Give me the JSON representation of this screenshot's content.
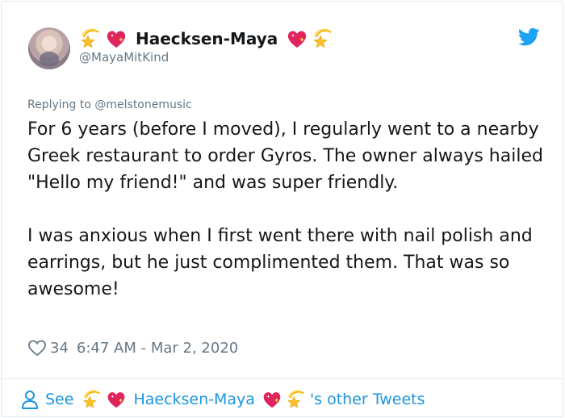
{
  "user": {
    "display_name": "Haecksen-Maya",
    "handle": "@MayaMitKind"
  },
  "reply": {
    "text": "Replying to @melstonemusic"
  },
  "tweet": {
    "paragraph_1": "For 6 years (before I moved), I regularly went to a nearby Greek restaurant to order Gyros. The owner always hailed \"Hello my friend!\" and was super friendly.",
    "paragraph_2": "I was anxious when I first went there with nail polish and earrings, but he just complimented them. That was so awesome!"
  },
  "stats": {
    "like_count": "34",
    "timestamp": "6:47 AM - Mar 2, 2020"
  },
  "footer": {
    "see_label": "See",
    "name": "Haecksen-Maya",
    "suffix": "'s other Tweets"
  },
  "icons": {
    "brand": "twitter-bird-icon",
    "like": "heart-outline-icon",
    "person": "person-icon",
    "emoji_star": "dizzy-star-emoji",
    "emoji_heart": "sparkling-heart-emoji"
  },
  "colors": {
    "brand_blue": "#1da1f2",
    "link_blue": "#1b95e0",
    "muted_gray": "#657786",
    "text": "#14171a"
  }
}
